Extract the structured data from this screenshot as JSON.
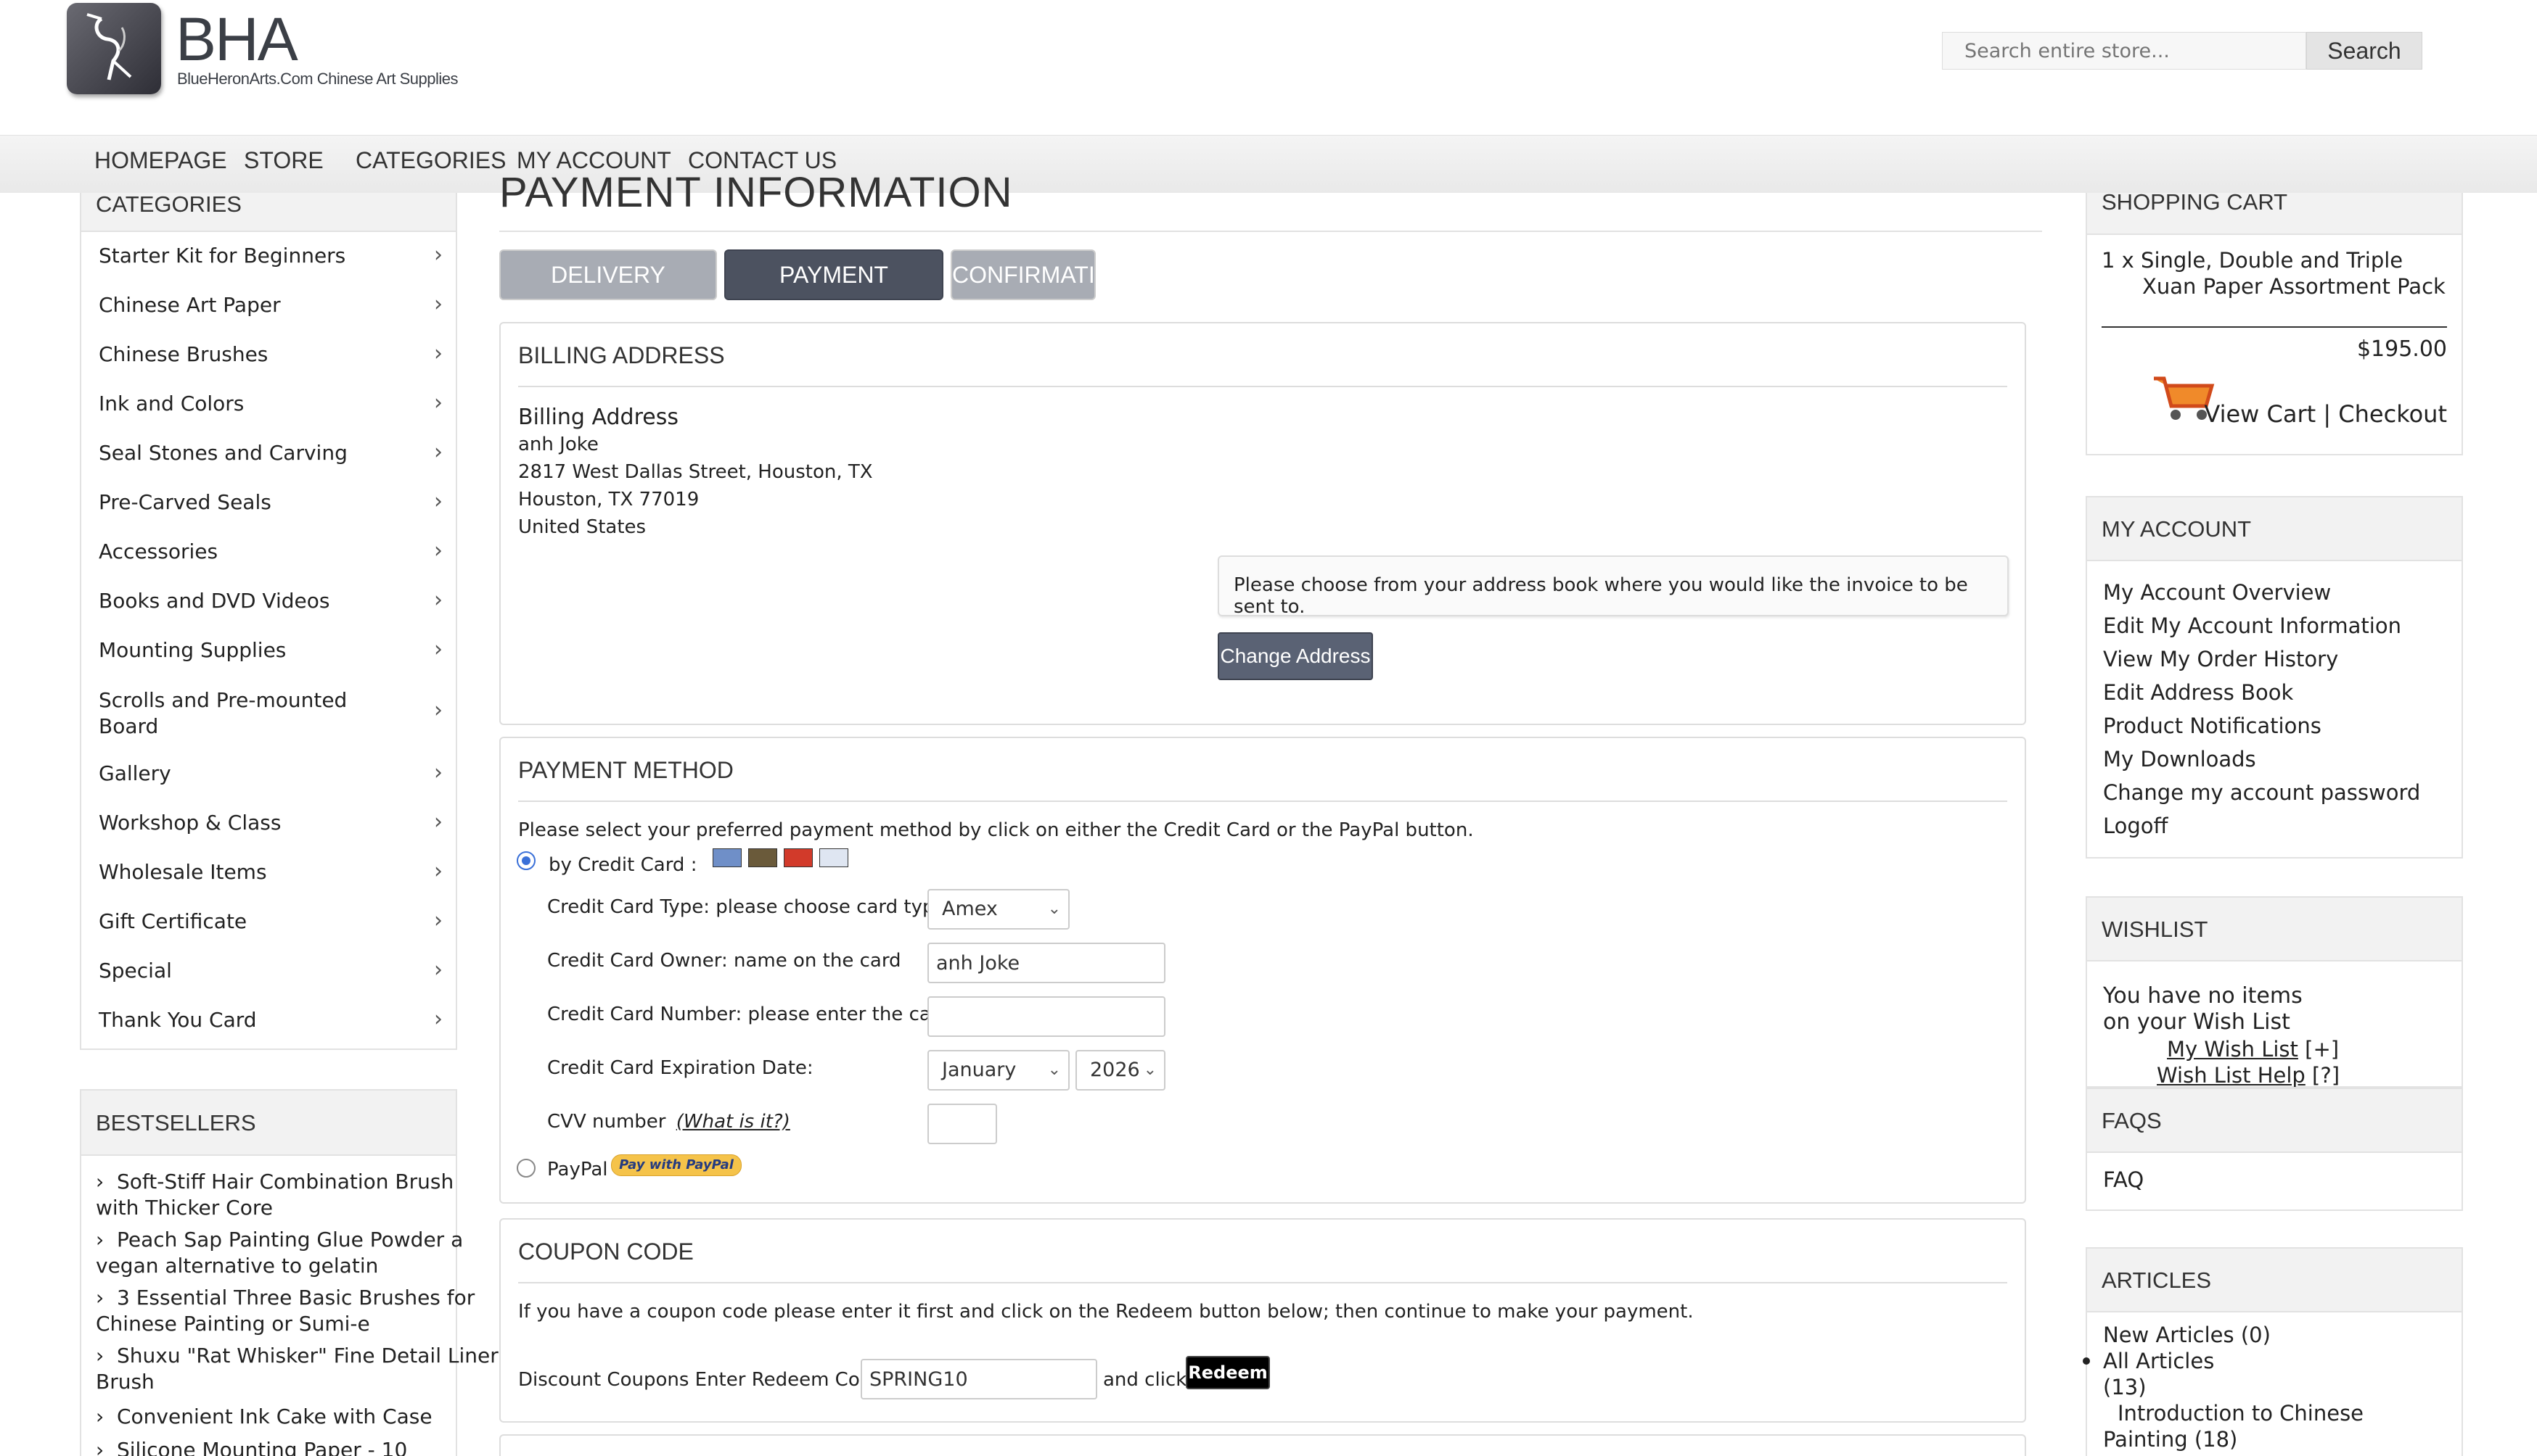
{
  "brand": {
    "title": "BHA",
    "subtitle": "BlueHeronArts.Com Chinese Art Supplies"
  },
  "search": {
    "placeholder": "Search entire store...",
    "button": "Search"
  },
  "nav": [
    "HOMEPAGE",
    "STORE",
    "CATEGORIES",
    "MY ACCOUNT",
    "CONTACT US"
  ],
  "categories": {
    "title": "CATEGORIES",
    "items": [
      "Starter Kit for Beginners",
      "Chinese Art Paper",
      "Chinese Brushes",
      "Ink and Colors",
      "Seal Stones and Carving",
      "Pre-Carved Seals",
      "Accessories",
      "Books and DVD Videos",
      "Mounting Supplies",
      "Scrolls and Pre-mounted Board",
      "Gallery",
      "Workshop & Class",
      "Wholesale Items",
      "Gift Certificate",
      "Special",
      "Thank You Card"
    ]
  },
  "bestsellers": {
    "title": "BESTSELLERS",
    "items": [
      "Soft-Stiff Hair Combination Brush with Thicker Core",
      "Peach Sap Painting Glue Powder a vegan alternative to gelatin",
      "3 Essential Three Basic Brushes for Chinese Painting or Sumi-e",
      "Shuxu \"Rat Whisker\" Fine Detail Liner Brush",
      "Convenient Ink Cake with Case",
      "Silicone Mounting Paper - 10"
    ]
  },
  "page": {
    "title": "PAYMENT INFORMATION",
    "steps": [
      "DELIVERY INFORMATION",
      "PAYMENT INFORMATION",
      "CONFIRMATION"
    ]
  },
  "billing": {
    "section_title": "BILLING ADDRESS",
    "heading": "Billing Address",
    "lines": [
      "anh Joke",
      "2817 West Dallas Street, Houston, TX",
      "Houston, TX 77019",
      "United States"
    ],
    "note": "Please choose from your address book where you would like the invoice to be sent to.",
    "change_button": "Change Address"
  },
  "payment": {
    "section_title": "PAYMENT METHOD",
    "intro": "Please select your preferred payment method by click on either the Credit Card or the PayPal button.",
    "credit_label": "by Credit Card :",
    "card_type_label": "Credit Card Type: please choose card type",
    "card_type_value": "Amex",
    "owner_label": "Credit Card Owner: name on the card",
    "owner_value": "anh Joke",
    "number_label": "Credit Card Number: please enter the card #",
    "number_value": "",
    "exp_label": "Credit Card Expiration Date:",
    "exp_month": "January",
    "exp_year": "2026",
    "cvv_label": "CVV number",
    "cvv_help": "(What is it?)",
    "paypal_label": "PayPal",
    "paypal_badge": "Pay with PayPal",
    "selected": "credit"
  },
  "coupon": {
    "section_title": "COUPON CODE",
    "intro": "If you have a coupon code please enter it first and click on the Redeem button below; then continue to make your payment.",
    "label": "Discount Coupons Enter Redeem Code",
    "value": "SPRING10",
    "and_click": "and click",
    "redeem": "Redeem"
  },
  "cart": {
    "title": "SHOPPING CART",
    "item_line1": "1 x Single, Double and Triple",
    "item_line2": "Xuan Paper Assortment Pack",
    "total": "$195.00",
    "view_cart": "View Cart | Checkout"
  },
  "account": {
    "title": "MY ACCOUNT",
    "links": [
      "My Account Overview",
      "Edit My Account Information",
      "View My Order History",
      "Edit Address Book",
      "Product Notifications",
      "My Downloads",
      "Change my account password",
      "Logoff"
    ]
  },
  "wishlist": {
    "title": "WISHLIST",
    "empty_line1": "You have no items",
    "empty_line2": "on your Wish List",
    "link1": "My Wish List",
    "link1_suffix": "[+]",
    "link2": "Wish List Help",
    "link2_suffix": "[?]"
  },
  "faqs": {
    "title": "FAQS",
    "link": "FAQ"
  },
  "articles": {
    "title": "ARTICLES",
    "new": "New Articles (0)",
    "all": "All Articles",
    "all_count": "(13)",
    "topic": "Introduction to Chinese",
    "topic2": "Painting (18)"
  },
  "colors": {
    "step_inactive": "#a8acb4",
    "step_active": "#4c5260",
    "button": "#5a6274"
  }
}
